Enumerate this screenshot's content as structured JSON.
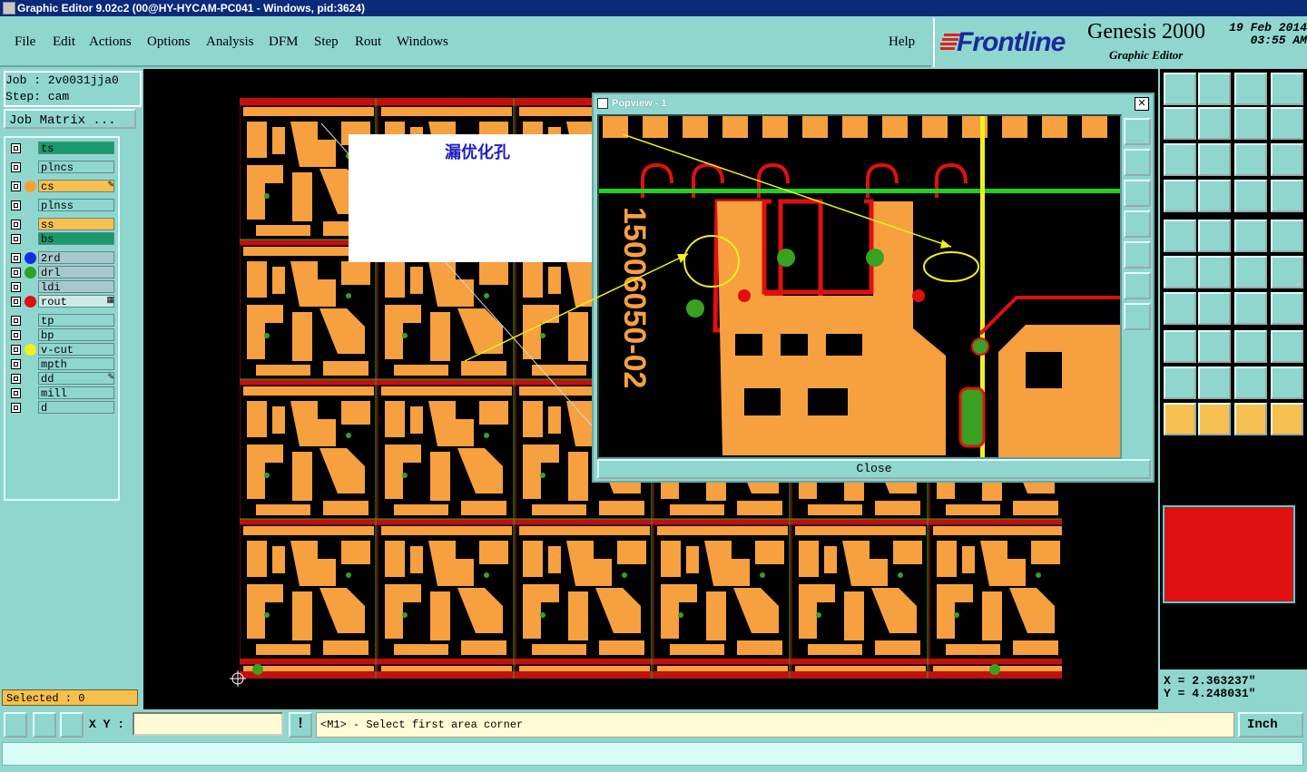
{
  "window": {
    "title": "Graphic Editor 9.02c2 (00@HY-HYCAM-PC041 - Windows, pid:3624)"
  },
  "menu": [
    "File",
    "Edit",
    "Actions",
    "Options",
    "Analysis",
    "DFM",
    "Step",
    "Rout",
    "Windows"
  ],
  "help_label": "Help",
  "brand": {
    "logo": "Frontline",
    "product": "Genesis 2000",
    "subtitle": "Graphic Editor",
    "date": "19 Feb 2014",
    "time": "03:55 AM"
  },
  "job": {
    "job_line": "Job : 2v0031jja0",
    "step_line": "Step: cam",
    "matrix_button": "Job Matrix ..."
  },
  "layers": [
    {
      "name": "ts",
      "bg": "#1a9a6a",
      "dot": ""
    },
    {
      "name": "plncs",
      "bg": "#8fd6cf",
      "dot": ""
    },
    {
      "name": "cs",
      "bg": "#f6c050",
      "dot": "#f6a030",
      "marker": "✎"
    },
    {
      "name": "plnss",
      "bg": "#8fd6cf",
      "dot": ""
    },
    {
      "name": "ss",
      "bg": "#f6c050",
      "dot": ""
    },
    {
      "name": "bs",
      "bg": "#1a9a6a",
      "dot": ""
    },
    {
      "name": "2rd",
      "bg": "#a8c8d0",
      "dot": "#1030e0"
    },
    {
      "name": "drl",
      "bg": "#a8c8d0",
      "dot": "#30a020"
    },
    {
      "name": "ldi",
      "bg": "#a8c8d0",
      "dot": ""
    },
    {
      "name": "rout",
      "bg": "#d0e8e8",
      "dot": "#e01010",
      "marker": "▦"
    },
    {
      "name": "tp",
      "bg": "#8fd6cf",
      "dot": ""
    },
    {
      "name": "bp",
      "bg": "#8fd6cf",
      "dot": ""
    },
    {
      "name": "v-cut",
      "bg": "#8fd6cf",
      "dot": "#f0f020"
    },
    {
      "name": "mpth",
      "bg": "#8fd6cf",
      "dot": ""
    },
    {
      "name": "dd",
      "bg": "#8fd6cf",
      "dot": "",
      "marker": "✎"
    },
    {
      "name": "mill",
      "bg": "#8fd6cf",
      "dot": ""
    },
    {
      "name": "d",
      "bg": "#8fd6cf",
      "dot": ""
    }
  ],
  "selected": "Selected : 0",
  "popview": {
    "title": "Popview - 1",
    "close_label": "Close",
    "board_text": "15006050-02"
  },
  "annotation": "漏优化孔",
  "coords": {
    "x": "X = 2.363237\"",
    "y": "Y = 4.248031\""
  },
  "bottom": {
    "xy_label": "X Y :",
    "xy_value": "",
    "message": "<M1> - Select first area corner",
    "unit": "Inch"
  },
  "colors": {
    "copper": "#f6a040",
    "route": "#e01010",
    "drill": "#3aa020",
    "vcut": "#f0f020",
    "panel_bg": "#8fd6cf"
  }
}
